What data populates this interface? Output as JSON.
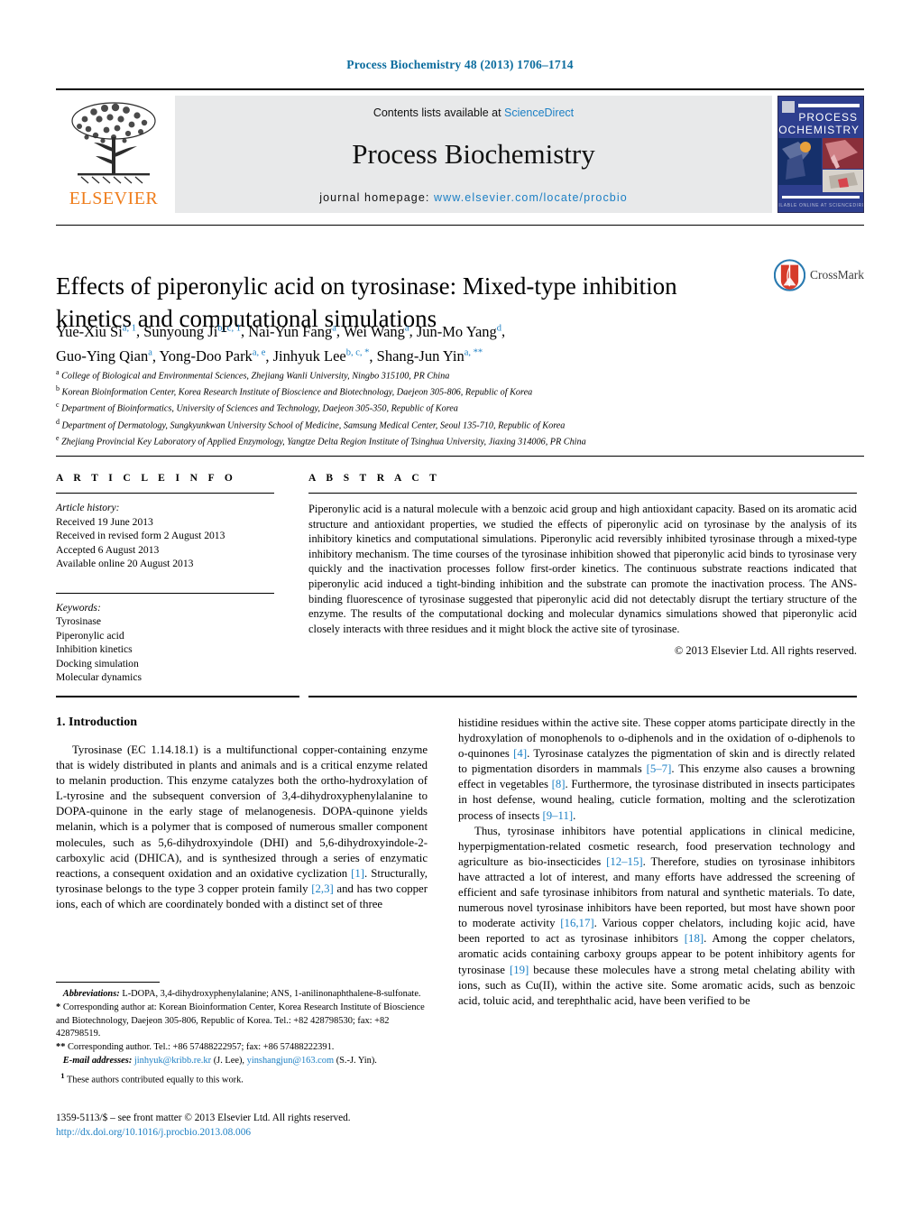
{
  "running_head": "Process Biochemistry 48 (2013) 1706–1714",
  "masthead": {
    "publisher_name": "ELSEVIER",
    "contents_prefix": "Contents lists available at ",
    "contents_link": "ScienceDirect",
    "journal_title": "Process Biochemistry",
    "homepage_prefix": "journal homepage: ",
    "homepage_url": "www.elsevier.com/locate/procbio",
    "cover_line1": "PROCESS",
    "cover_line2": "BIOCHEMISTRY"
  },
  "article": {
    "title": "Effects of piperonylic acid on tyrosinase: Mixed-type inhibition kinetics and computational simulations",
    "crossmark_label": "CrossMark",
    "authors_line1_parts": [
      {
        "name": "Yue-Xiu Si",
        "sup": "a, 1"
      },
      {
        "name": "Sunyoung Ji",
        "sup": "b, c, 1"
      },
      {
        "name": "Nai-Yun Fang",
        "sup": "a"
      },
      {
        "name": "Wei Wang",
        "sup": "a"
      },
      {
        "name": "Jun-Mo Yang",
        "sup": "d"
      }
    ],
    "authors_line2_parts": [
      {
        "name": "Guo-Ying Qian",
        "sup": "a"
      },
      {
        "name": "Yong-Doo Park",
        "sup": "a, e"
      },
      {
        "name": "Jinhyuk Lee",
        "sup": "b, c, *"
      },
      {
        "name": "Shang-Jun Yin",
        "sup": "a, **"
      }
    ],
    "affiliations": [
      {
        "mark": "a",
        "text": "College of Biological and Environmental Sciences, Zhejiang Wanli University, Ningbo 315100, PR China"
      },
      {
        "mark": "b",
        "text": "Korean Bioinformation Center, Korea Research Institute of Bioscience and Biotechnology, Daejeon 305-806, Republic of Korea"
      },
      {
        "mark": "c",
        "text": "Department of Bioinformatics, University of Sciences and Technology, Daejeon 305-350, Republic of Korea"
      },
      {
        "mark": "d",
        "text": "Department of Dermatology, Sungkyunkwan University School of Medicine, Samsung Medical Center, Seoul 135-710, Republic of Korea"
      },
      {
        "mark": "e",
        "text": "Zhejiang Provincial Key Laboratory of Applied Enzymology, Yangtze Delta Region Institute of Tsinghua University, Jiaxing 314006, PR China"
      }
    ]
  },
  "article_info": {
    "heading": "A R T I C L E   I N F O",
    "history_label": "Article history:",
    "history": [
      "Received 19 June 2013",
      "Received in revised form 2 August 2013",
      "Accepted 6 August 2013",
      "Available online 20 August 2013"
    ],
    "keywords_label": "Keywords:",
    "keywords": [
      "Tyrosinase",
      "Piperonylic acid",
      "Inhibition kinetics",
      "Docking simulation",
      "Molecular dynamics"
    ]
  },
  "abstract": {
    "heading": "A B S T R A C T",
    "text": "Piperonylic acid is a natural molecule with a benzoic acid group and high antioxidant capacity. Based on its aromatic acid structure and antioxidant properties, we studied the effects of piperonylic acid on tyrosinase by the analysis of its inhibitory kinetics and computational simulations. Piperonylic acid reversibly inhibited tyrosinase through a mixed-type inhibitory mechanism. The time courses of the tyrosinase inhibition showed that piperonylic acid binds to tyrosinase very quickly and the inactivation processes follow first-order kinetics. The continuous substrate reactions indicated that piperonylic acid induced a tight-binding inhibition and the substrate can promote the inactivation process. The ANS-binding fluorescence of tyrosinase suggested that piperonylic acid did not detectably disrupt the tertiary structure of the enzyme. The results of the computational docking and molecular dynamics simulations showed that piperonylic acid closely interacts with three residues and it might block the active site of tyrosinase.",
    "copyright": "© 2013 Elsevier Ltd. All rights reserved."
  },
  "body": {
    "section_heading": "1.  Introduction",
    "left_paragraphs": [
      "Tyrosinase (EC 1.14.18.1) is a multifunctional copper-containing enzyme that is widely distributed in plants and animals and is a critical enzyme related to melanin production. This enzyme catalyzes both the ortho-hydroxylation of L-tyrosine and the subsequent conversion of 3,4-dihydroxyphenylalanine to DOPA-quinone in the early stage of melanogenesis. DOPA-quinone yields melanin, which is a polymer that is composed of numerous smaller component molecules, such as 5,6-dihydroxyindole (DHI) and 5,6-dihydroxyindole-2-carboxylic acid (DHICA), and is synthesized through a series of enzymatic reactions, a consequent oxidation and an oxidative cyclization [1]. Structurally, tyrosinase belongs to the type 3 copper protein family [2,3] and has two copper ions, each of which are coordinately bonded with a distinct set of three"
    ],
    "right_paragraphs": [
      "histidine residues within the active site. These copper atoms participate directly in the hydroxylation of monophenols to o-diphenols and in the oxidation of o-diphenols to o-quinones [4]. Tyrosinase catalyzes the pigmentation of skin and is directly related to pigmentation disorders in mammals [5–7]. This enzyme also causes a browning effect in vegetables [8]. Furthermore, the tyrosinase distributed in insects participates in host defense, wound healing, cuticle formation, molting and the sclerotization process of insects [9–11].",
      "Thus, tyrosinase inhibitors have potential applications in clinical medicine, hyperpigmentation-related cosmetic research, food preservation technology and agriculture as bio-insecticides [12–15]. Therefore, studies on tyrosinase inhibitors have attracted a lot of interest, and many efforts have addressed the screening of efficient and safe tyrosinase inhibitors from natural and synthetic materials. To date, numerous novel tyrosinase inhibitors have been reported, but most have shown poor to moderate activity [16,17]. Various copper chelators, including kojic acid, have been reported to act as tyrosinase inhibitors [18]. Among the copper chelators, aromatic acids containing carboxy groups appear to be potent inhibitory agents for tyrosinase [19] because these molecules have a strong metal chelating ability with ions, such as Cu(II), within the active site. Some aromatic acids, such as benzoic acid, toluic acid, and terephthalic acid, have been verified to be"
    ]
  },
  "footnotes": {
    "abbreviations_label": "Abbreviations:",
    "abbreviations_text": "L-DOPA, 3,4-dihydroxyphenylalanine; ANS, 1-anilinonaphthalene-8-sulfonate.",
    "corresponding1_marker": "*",
    "corresponding1_text": "Corresponding author at: Korean Bioinformation Center, Korea Research Institute of Bioscience and Biotechnology, Daejeon 305-806, Republic of Korea. Tel.: +82 428798530; fax: +82 428798519.",
    "corresponding2_marker": "**",
    "corresponding2_text": "Corresponding author. Tel.: +86 57488222957; fax: +86 57488222391.",
    "email_label": "E-mail addresses:",
    "email1": "jinhyuk@kribb.re.kr",
    "email1_owner": "(J. Lee),",
    "email2": "yinshangjun@163.com",
    "email2_owner": "(S.-J. Yin).",
    "equal_marker": "1",
    "equal_text": "These authors contributed equally to this work."
  },
  "imprint": {
    "line1": "1359-5113/$ – see front matter © 2013 Elsevier Ltd. All rights reserved.",
    "doi": "http://dx.doi.org/10.1016/j.procbio.2013.08.006"
  },
  "colors": {
    "link_blue": "#1b7fc4",
    "header_blue": "#0b6c9e",
    "elsevier_orange": "#ef7c1a",
    "masthead_grey": "#e8e9ea"
  }
}
